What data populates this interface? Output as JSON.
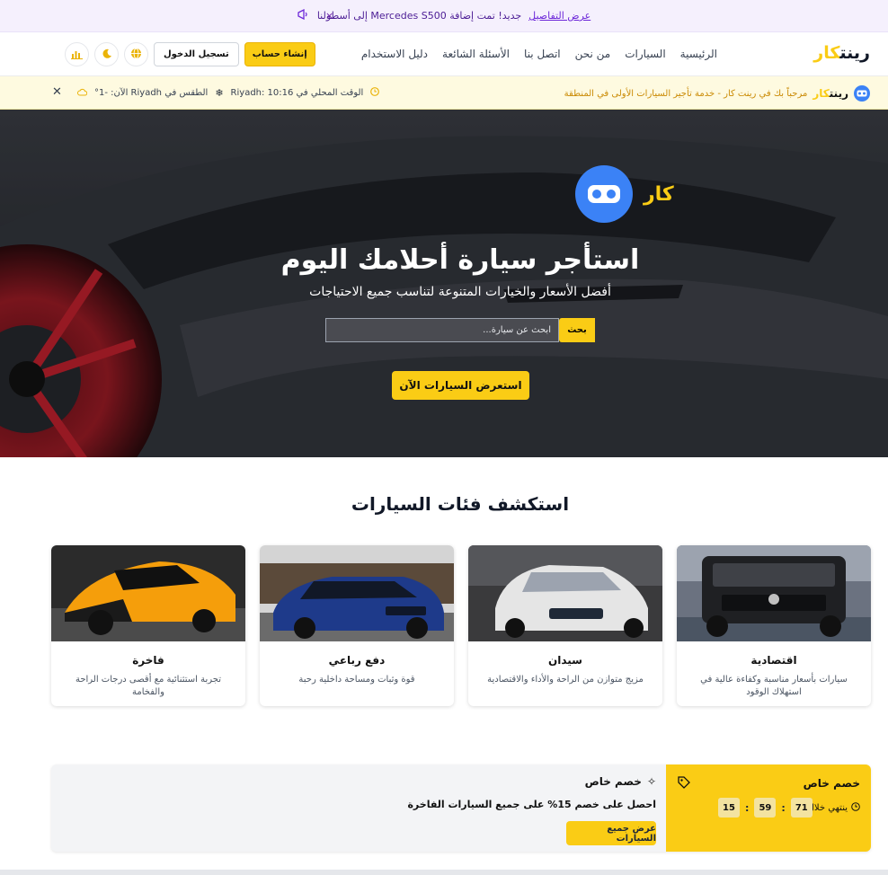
{
  "announcement": {
    "message": "جديد! تمت إضافة Mercedes S500 إلى أسطولنا",
    "link": "عرض التفاصيل",
    "icon": "megaphone-icon",
    "close": "×"
  },
  "nav": {
    "logo_main": "رينت",
    "logo_accent": "كار",
    "links": [
      "الرئيسية",
      "السيارات",
      "من نحن",
      "اتصل بنا",
      "الأسئلة الشائعة",
      "دليل الاستخدام"
    ],
    "login": "تسجيل الدخول",
    "signup": "إنشاء حساب"
  },
  "infobar": {
    "welcome": "مرحباً بك في رينت كار - خدمة تأجير السيارات الأولى في المنطقة",
    "brand_main": "رينت",
    "brand_accent": "كار",
    "weather": "الطقس في Riyadh الآن: -1°",
    "time": "الوقت المحلي في Riyadh: 10:16",
    "close": "✕"
  },
  "hero": {
    "brand_text": "كار",
    "title": "استأجر سيارة أحلامك اليوم",
    "subtitle": "أفضل الأسعار والخيارات المتنوعة لتناسب جميع الاحتياجات",
    "search_placeholder": "ابحث عن سيارة...",
    "search_button": "بحث",
    "cta": "استعرض السيارات الآن"
  },
  "categories": {
    "title": "استكشف فئات السيارات",
    "items": [
      {
        "title": "اقتصادية",
        "desc": "سيارات بأسعار مناسبة وكفاءة عالية في استهلاك الوقود"
      },
      {
        "title": "سيدان",
        "desc": "مزيج متوازن من الراحة والأداء والاقتصادية"
      },
      {
        "title": "دفع رباعي",
        "desc": "قوة وثبات ومساحة داخلية رحبة"
      },
      {
        "title": "فاخرة",
        "desc": "تجربة استثنائية مع أقصى درجات الراحة والفخامة"
      }
    ]
  },
  "offer": {
    "badge_title": "خصم خاص",
    "ends_label": "ينتهي خلال:",
    "timer": [
      "71",
      "59",
      "15"
    ],
    "heading": "خصم خاص",
    "text": "احصل على خصم 15% على جميع السيارات الفاخرة",
    "button": "عرض جميع السيارات"
  },
  "colors": {
    "accent": "#facc15",
    "brand_blue": "#3b82f6",
    "announce_bg": "#f5f0fd",
    "infobar_bg": "#fefae0"
  }
}
